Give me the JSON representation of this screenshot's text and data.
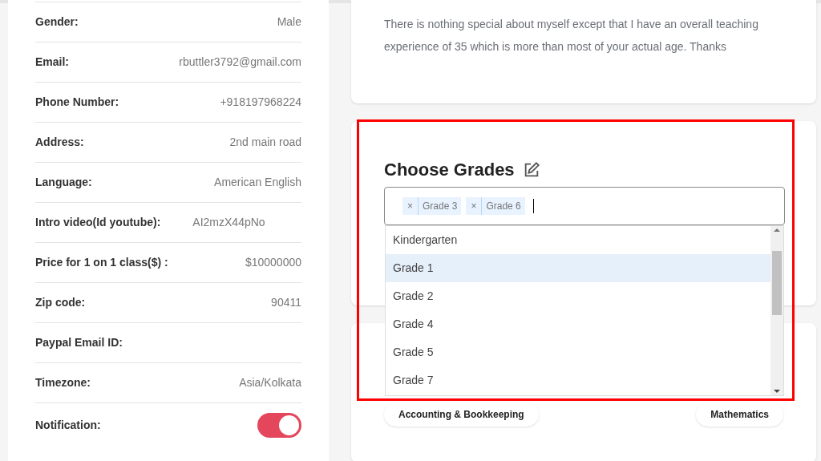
{
  "profile": {
    "rows": [
      {
        "label": "Gender:",
        "value": "Male"
      },
      {
        "label": "Email:",
        "value": "rbuttler3792@gmail.com"
      },
      {
        "label": "Phone Number:",
        "value": "+918197968224"
      },
      {
        "label": "Address:",
        "value": "2nd main road"
      },
      {
        "label": "Language:",
        "value": "American English"
      },
      {
        "label": "Intro video(**Id youtube**):",
        "value": "AI2mzX44pNo",
        "kind": "inline"
      },
      {
        "label": "Price for 1 on 1 class($) :",
        "value": "$10000000"
      },
      {
        "label": "Zip code:",
        "value": "90411"
      },
      {
        "label": "Paypal Email ID:"
      },
      {
        "label": "Timezone:",
        "value": "Asia/Kolkata"
      },
      {
        "label": "Notification:",
        "kind": "toggle",
        "on": true
      }
    ]
  },
  "about": {
    "text": "There is nothing special about myself except that I have an overall teaching experience of 35 which is more than most of your actual age. Thanks"
  },
  "grades": {
    "title": "Choose Grades",
    "chips": [
      {
        "remove": "×",
        "label": "Grade 3"
      },
      {
        "remove": "×",
        "label": "Grade 6"
      }
    ],
    "options": [
      {
        "label": "Kindergarten",
        "highlighted": false
      },
      {
        "label": "Grade 1",
        "highlighted": true
      },
      {
        "label": "Grade 2",
        "highlighted": false
      },
      {
        "label": "Grade 4",
        "highlighted": false
      },
      {
        "label": "Grade 5",
        "highlighted": false
      },
      {
        "label": "Grade 7",
        "highlighted": false
      }
    ]
  },
  "subjects": [
    {
      "label": "Accounting & Bookkeeping"
    },
    {
      "label": "Mathematics"
    }
  ]
}
